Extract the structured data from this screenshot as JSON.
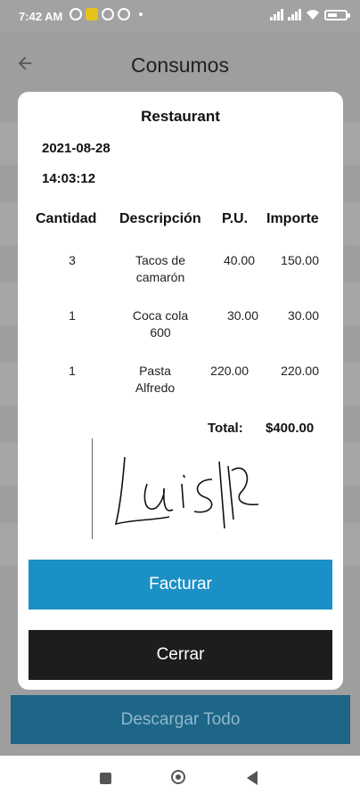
{
  "status_bar": {
    "time": "7:42 AM"
  },
  "app_bar": {
    "title": "Consumos",
    "back_icon": "back-arrow-icon"
  },
  "dialog": {
    "title": "Restaurant",
    "date": "2021-08-28",
    "time": "14:03:12",
    "columns": [
      "Cantidad",
      "Descripción",
      "P.U.",
      "Importe"
    ],
    "rows": [
      {
        "qty": "3",
        "desc": "Tacos de camarón",
        "pu": "40.00",
        "importe": "150.00"
      },
      {
        "qty": "1",
        "desc": "Coca cola 600",
        "pu": "30.00",
        "importe": "30.00"
      },
      {
        "qty": "1",
        "desc": "Pasta Alfredo",
        "pu": "220.00",
        "importe": "220.00"
      }
    ],
    "total_label": "Total:",
    "total_value": "$400.00",
    "signature_text": "Luis",
    "button_factura": "Facturar",
    "button_cerrar": "Cerrar"
  },
  "background": {
    "download_all": "Descargar Todo"
  },
  "colors": {
    "primary": "#1b90c6",
    "dark": "#1d1d1d",
    "download": "#1e6688"
  }
}
